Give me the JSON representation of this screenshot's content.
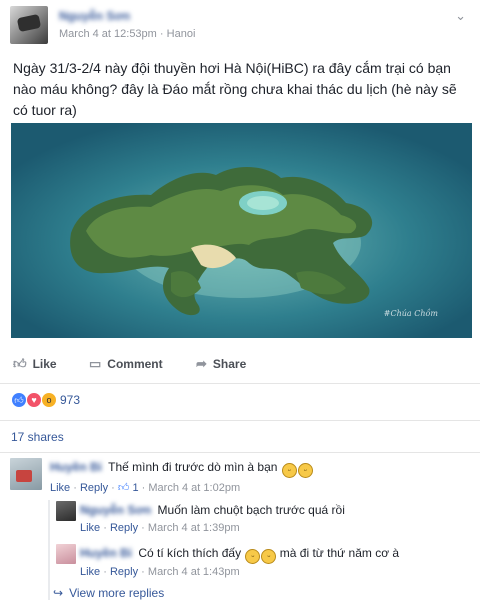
{
  "post": {
    "author": "Nguyễn Sơn",
    "time": "March 4 at 12:53pm",
    "separator": "·",
    "location": "Hanoi",
    "text": "Ngày 31/3-2/4 này đội thuyền hơi Hà Nội(HiBC) ra đây cắm trại có bạn nào máu không? đây là Đáo mắt rồng chưa khai thác du lịch (hè này sẽ có tuor ra)",
    "photo_watermark": "#Chúa Chồm"
  },
  "actions": {
    "like": "Like",
    "comment": "Comment",
    "share": "Share"
  },
  "icons": {
    "like": "thumbs-up-icon",
    "comment": "comment-icon",
    "share": "share-arrow-icon",
    "menu": "chevron-down-icon"
  },
  "reactions": {
    "count": "973"
  },
  "shares": "17 shares",
  "comments": [
    {
      "author": "Huyền Bi",
      "text": "Thế mình đi trước dò mìn à bạn",
      "like": "Like",
      "reply": "Reply",
      "likes": "1",
      "time": "March 4 at 1:02pm",
      "replies": [
        {
          "author": "Nguyễn Sơn",
          "text": "Muốn làm chuột bạch trước quá rồi",
          "like": "Like",
          "reply": "Reply",
          "time": "March 4 at 1:39pm"
        },
        {
          "author": "Huyền Bi",
          "text": "Có tí kích thích đấy",
          "text2": "mà đi từ thứ năm cơ à",
          "like": "Like",
          "reply": "Reply",
          "time": "March 4 at 1:43pm"
        }
      ]
    }
  ],
  "view_more": "View more replies",
  "dot": "·",
  "colors": {
    "link": "#365899",
    "meta": "#90949c",
    "like_blue": "#4080ff"
  }
}
